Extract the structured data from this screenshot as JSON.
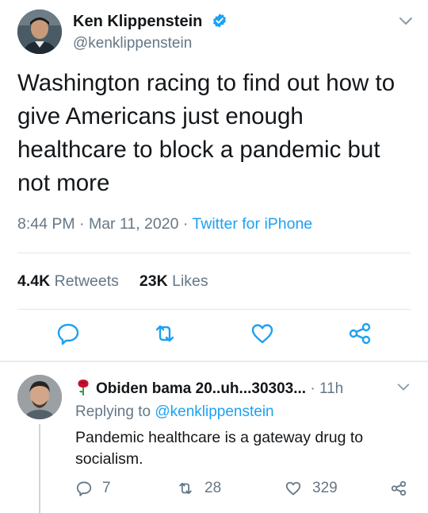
{
  "tweet": {
    "author_name": "Ken Klippenstein",
    "author_handle": "@kenklippenstein",
    "text": "Washington racing to find out how to give Americans just enough healthcare to block a pandemic but not more",
    "time": "8:44 PM",
    "date": "Mar 11, 2020",
    "source": "Twitter for iPhone",
    "retweets_count": "4.4K",
    "retweets_label": "Retweets",
    "likes_count": "23K",
    "likes_label": "Likes"
  },
  "reply": {
    "author_name": "Obiden bama 20..uh...30303...",
    "time": "11h",
    "replying_prefix": "Replying to",
    "replying_to": "@kenklippenstein",
    "text": "Pandemic healthcare is a gateway drug to socialism.",
    "reply_count": "7",
    "retweet_count": "28",
    "like_count": "329"
  },
  "colors": {
    "link": "#1da1f2",
    "secondary_text": "#657786",
    "divider": "#e1e8ed",
    "rose": "#c8102e"
  },
  "icons": [
    "verified-icon",
    "chevron-down-icon",
    "reply-icon",
    "retweet-icon",
    "like-icon",
    "share-icon",
    "rose-icon"
  ]
}
